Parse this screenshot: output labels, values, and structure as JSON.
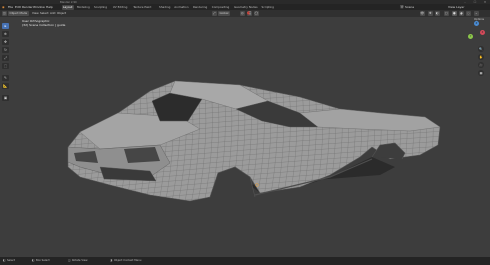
{
  "window": {
    "title": "Blender 2.90",
    "min": "–",
    "max": "☐",
    "close": "✕"
  },
  "menu": {
    "file": "File",
    "edit": "Edit",
    "render": "Render",
    "window": "Window",
    "help": "Help"
  },
  "workspaces": [
    "Layout",
    "Modeling",
    "Sculpting",
    "UV Editing",
    "Texture Paint",
    "Shading",
    "Animation",
    "Rendering",
    "Compositing",
    "Geometry Nodes",
    "Scripting"
  ],
  "active_workspace": "Layout",
  "scene": {
    "label": "Scene",
    "view_layer": "View Layer"
  },
  "header": {
    "mode": "Object Mode",
    "view": "View",
    "select": "Select",
    "add": "Add",
    "object": "Object",
    "transform": "Global"
  },
  "viewport_overlay": {
    "view_name": "User Orthographic",
    "collection": "(32) Scene Collection | guide"
  },
  "options": "Options",
  "tools": [
    "select-box",
    "cursor",
    "move",
    "rotate",
    "scale",
    "transform",
    "annotate",
    "measure",
    "add-cube"
  ],
  "tool_glyphs": [
    "▸",
    "⊕",
    "✥",
    "↻",
    "⤢",
    "⬚",
    "✎",
    "📐",
    "▣"
  ],
  "gizmo": {
    "x": "X",
    "y": "Y",
    "z": "Z",
    "x_color": "#d44a5a",
    "y_color": "#8cc84b",
    "z_color": "#4a8cd4"
  },
  "nav_glyphs": [
    "🔍",
    "✋",
    "🎥",
    "▦"
  ],
  "status": {
    "select": "Select",
    "box_select": "Box Select",
    "rotate_view": "Rotate View",
    "context_menu": "Object Context Menu"
  },
  "colors": {
    "accent": "#4772b3",
    "background": "#3d3d3d",
    "mesh": "#9a9a9a",
    "wire": "#6b6b6b"
  }
}
